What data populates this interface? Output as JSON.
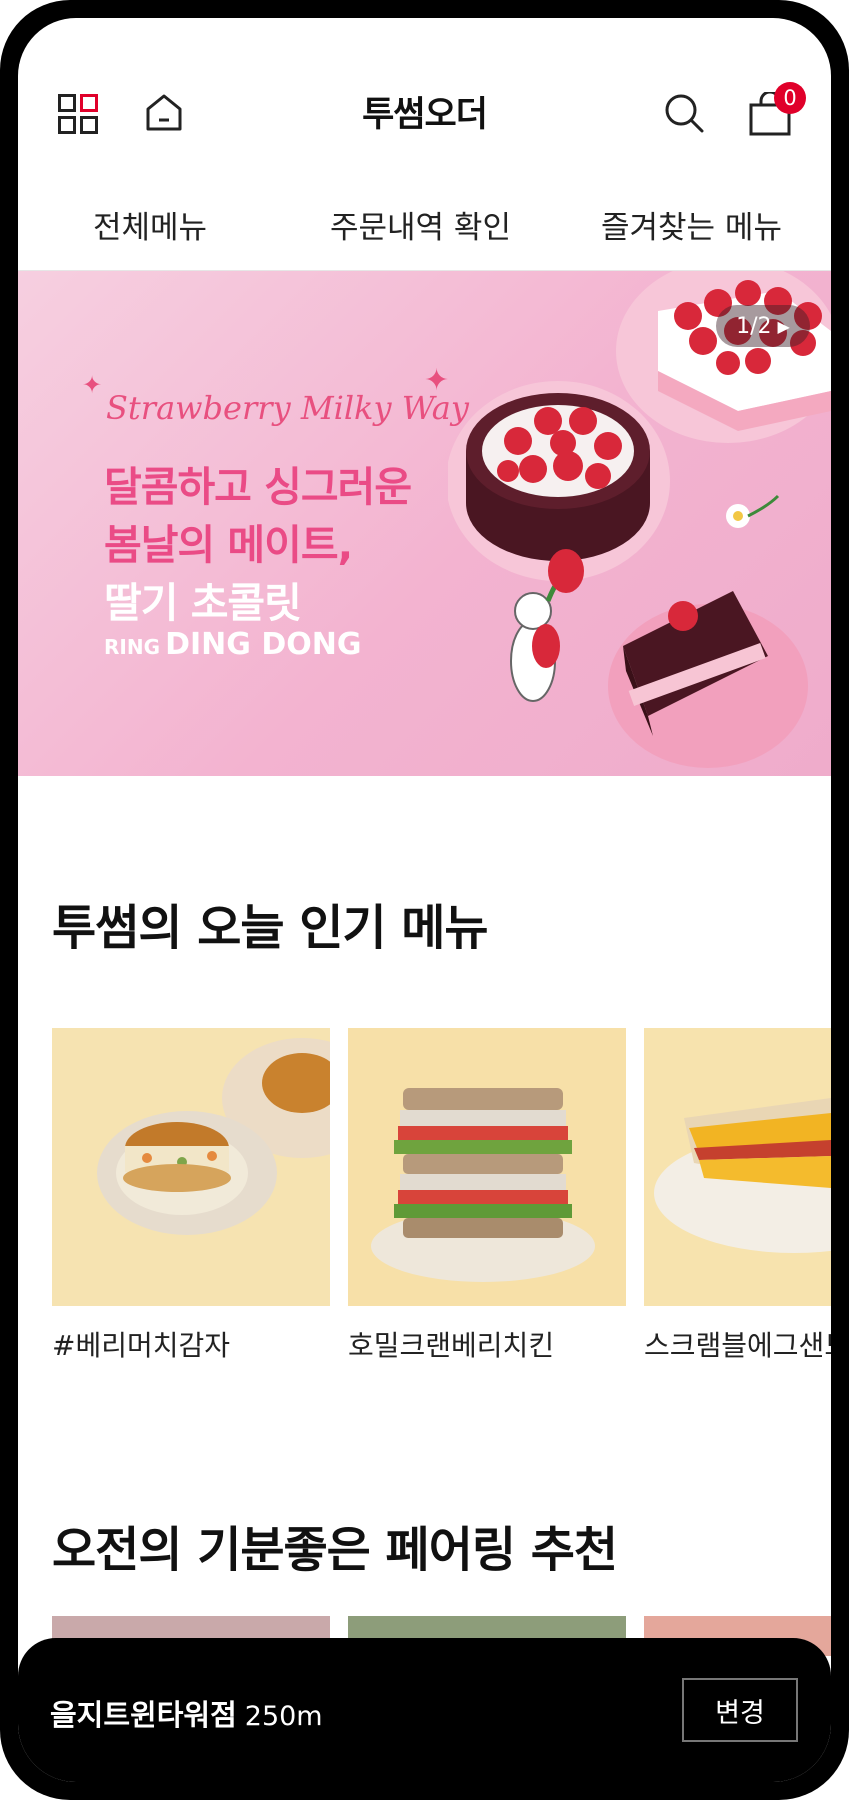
{
  "header": {
    "title": "투썸오더",
    "cart_count": "0",
    "icons": [
      "grid-menu-icon",
      "home-icon",
      "search-icon",
      "cart-icon"
    ]
  },
  "tabs": [
    "전체메뉴",
    "주문내역 확인",
    "즐겨찾는 메뉴"
  ],
  "banner": {
    "script_title": "Strawberry Milky Way",
    "line1": "달콤하고 싱그러운",
    "line2": "봄날의 메이트,",
    "line3": "딸기 초콜릿",
    "ring_small": "RING",
    "ring_big": "DING DONG",
    "pager": "1/2",
    "colors": {
      "pink_text": "#ea4b86",
      "bg": "#f4bdd6"
    }
  },
  "popular": {
    "title": "투썸의 오늘 인기 메뉴",
    "items": [
      {
        "label": "#베리머치감자"
      },
      {
        "label": "호밀크랜베리치킨"
      },
      {
        "label": "스크램블에그샌드"
      }
    ]
  },
  "pairing": {
    "title": "오전의 기분좋은 페어링 추천"
  },
  "store": {
    "name": "을지트윈타워점",
    "distance": "250m",
    "change_label": "변경"
  }
}
